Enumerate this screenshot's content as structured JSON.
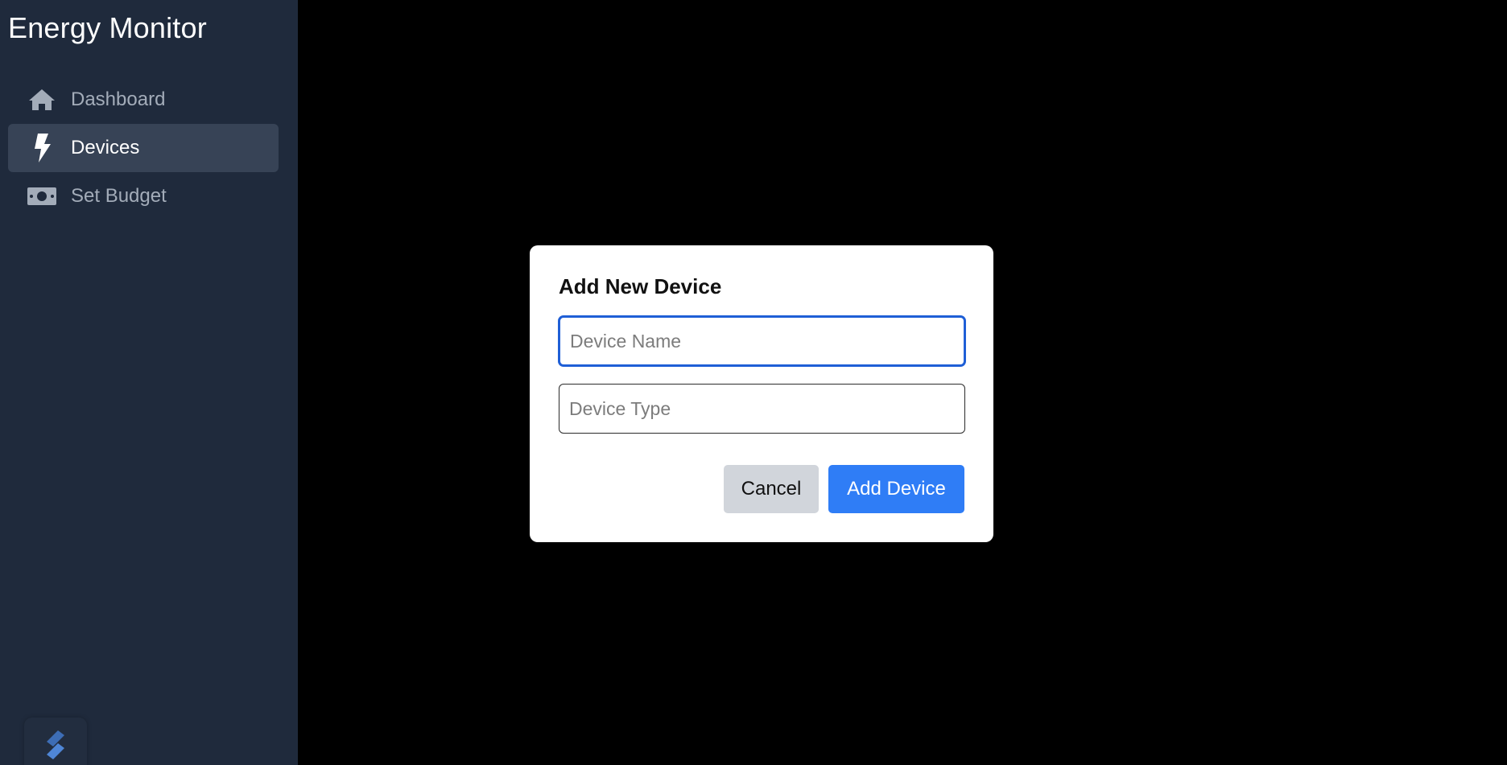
{
  "app": {
    "title": "Energy Monitor"
  },
  "sidebar": {
    "items": [
      {
        "label": "Dashboard",
        "icon": "home-icon",
        "active": false
      },
      {
        "label": "Devices",
        "icon": "bolt-icon",
        "active": true
      },
      {
        "label": "Set Budget",
        "icon": "money-bill-icon",
        "active": false
      }
    ]
  },
  "modal": {
    "title": "Add New Device",
    "device_name": {
      "value": "",
      "placeholder": "Device Name"
    },
    "device_type": {
      "value": "",
      "placeholder": "Device Type"
    },
    "cancel_label": "Cancel",
    "submit_label": "Add Device"
  },
  "colors": {
    "sidebar_bg": "#1f2a3c",
    "active_item_bg": "#374356",
    "primary_button": "#2f7df6",
    "cancel_button": "#d1d5db",
    "overlay": "#000000",
    "focus_ring": "#1f5fd6"
  }
}
